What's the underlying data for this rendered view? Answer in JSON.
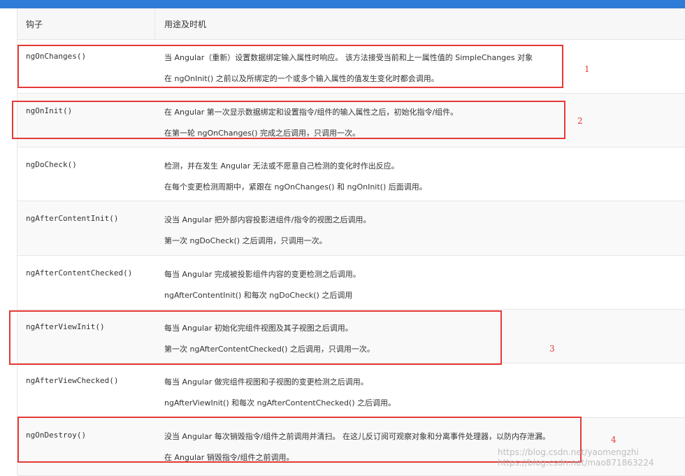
{
  "header": {
    "col1": "钩子",
    "col2": "用途及时机"
  },
  "rows": [
    {
      "hook": "ngOnChanges()",
      "line1": "当 Angular（重新）设置数据绑定输入属性时响应。 该方法接受当前和上一属性值的 SimpleChanges 对象",
      "line2": "在 ngOnInit() 之前以及所绑定的一个或多个输入属性的值发生变化时都会调用。"
    },
    {
      "hook": "ngOnInit()",
      "line1": "在 Angular 第一次显示数据绑定和设置指令/组件的输入属性之后，初始化指令/组件。",
      "line2": "在第一轮 ngOnChanges() 完成之后调用，只调用一次。"
    },
    {
      "hook": "ngDoCheck()",
      "line1": "检测，并在发生 Angular 无法或不愿意自己检测的变化时作出反应。",
      "line2": "在每个变更检测周期中，紧跟在 ngOnChanges() 和 ngOnInit() 后面调用。"
    },
    {
      "hook": "ngAfterContentInit()",
      "line1": "没当 Angular 把外部内容投影进组件/指令的视图之后调用。",
      "line2": "第一次 ngDoCheck() 之后调用，只调用一次。"
    },
    {
      "hook": "ngAfterContentChecked()",
      "line1": "每当 Angular 完成被投影组件内容的变更检测之后调用。",
      "line2": "ngAfterContentInit() 和每次 ngDoCheck() 之后调用"
    },
    {
      "hook": "ngAfterViewInit()",
      "line1": "每当 Angular 初始化完组件视图及其子视图之后调用。",
      "line2": "第一次 ngAfterContentChecked() 之后调用，只调用一次。"
    },
    {
      "hook": "ngAfterViewChecked()",
      "line1": "每当 Angular 做完组件视图和子视图的变更检测之后调用。",
      "line2": "ngAfterViewInit() 和每次 ngAfterContentChecked() 之后调用。"
    },
    {
      "hook": "ngOnDestroy()",
      "line1": "没当 Angular 每次销毁指令/组件之前调用并清扫。 在这儿反订阅可观察对象和分离事件处理器，以防内存泄漏。",
      "line2": "在 Angular 销毁指令/组件之前调用。"
    }
  ],
  "annotations": {
    "n1": "1",
    "n2": "2",
    "n3": "3",
    "n4": "4"
  },
  "watermark": {
    "line1": "https://blog.csdn.net/yaomengzhi",
    "line2": "https://blog.csdn.net/mao871863224"
  },
  "colors": {
    "topbar": "#2f7bd8",
    "annotation": "#e53935"
  }
}
